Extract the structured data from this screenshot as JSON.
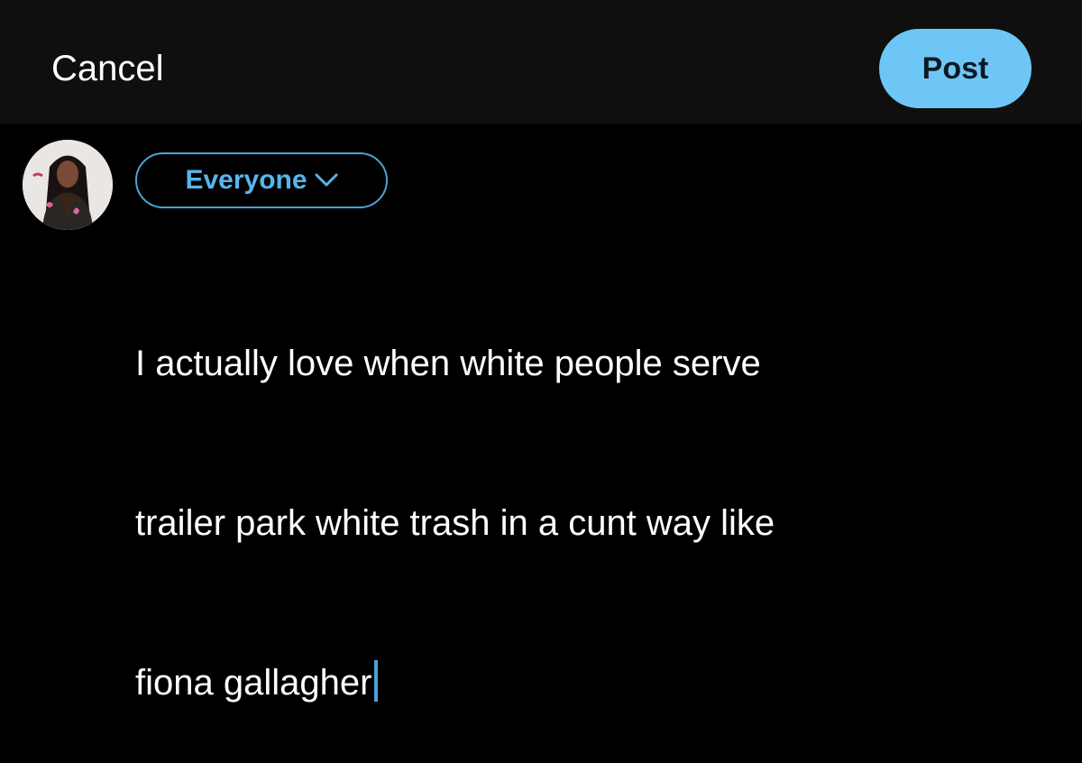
{
  "header": {
    "cancel_label": "Cancel",
    "post_label": "Post"
  },
  "composer": {
    "audience_label": "Everyone",
    "audience_icon": "chevron-down-icon",
    "lines": [
      "I actually love when white people serve",
      "trailer park white trash in a cunt way like",
      "fiona gallagher"
    ]
  },
  "colors": {
    "background": "#000000",
    "header_background": "#0f0f0f",
    "accent": "#6ec6f7",
    "audience_text": "#58b5ec",
    "cursor": "#4aa3d8"
  }
}
